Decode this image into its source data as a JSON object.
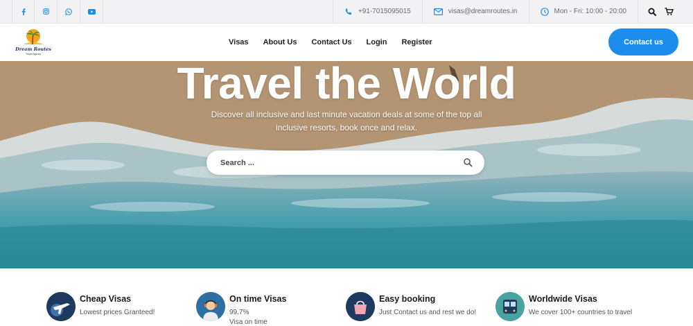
{
  "topbar": {
    "social": [
      {
        "icon": "facebook-icon"
      },
      {
        "icon": "instagram-icon"
      },
      {
        "icon": "whatsapp-icon"
      },
      {
        "icon": "youtube-icon"
      }
    ],
    "phone": "+91-7015095015",
    "email": "visas@dreamroutes.in",
    "hours": "Mon - Fri: 10:00 - 20:00"
  },
  "header": {
    "logo_title": "Dream Routes",
    "logo_subtitle": "Travel Agency",
    "nav": [
      "Visas",
      "About Us",
      "Contact Us",
      "Login",
      "Register"
    ],
    "cta": "Contact us"
  },
  "hero": {
    "title": "Travel the World",
    "subtitle": "Discover all inclusive and last minute vacation deals at some of the top all inclusive resorts, book once and relax.",
    "search_placeholder": "Search ..."
  },
  "features": [
    {
      "title": "Cheap Visas",
      "desc": "Lowest prices Granteed!",
      "icon": "airplane-icon",
      "color": "#1f3a5f"
    },
    {
      "title": "On time Visas",
      "desc": "99.7%",
      "desc2": "Visa on time",
      "icon": "support-agent-icon",
      "color": "#2e6fa3"
    },
    {
      "title": "Easy booking",
      "desc": "Just Contact us and rest we do!",
      "icon": "shopping-bag-icon",
      "color": "#1f3a5f"
    },
    {
      "title": "Worldwide Visas",
      "desc": "We cover 100+ countries to travel",
      "icon": "bus-icon",
      "color": "#4aa3a0"
    }
  ],
  "colors": {
    "accent": "#1c8dec",
    "social_icon": "#1c8dec"
  }
}
